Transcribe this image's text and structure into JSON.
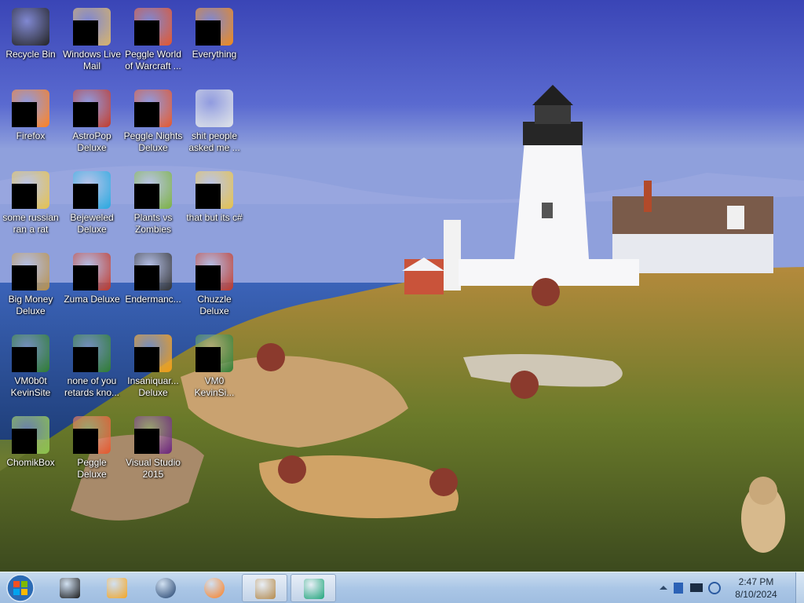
{
  "desktop_icons": [
    {
      "label": "Recycle Bin",
      "icon": "recycle-bin-icon",
      "censored": false
    },
    {
      "label": "Windows Live Mail",
      "icon": "mail-icon",
      "censored": true
    },
    {
      "label": "Peggle World of Warcraft ...",
      "icon": "peggle-icon",
      "censored": true
    },
    {
      "label": "Everything",
      "icon": "search-app-icon",
      "censored": true
    },
    {
      "label": "Firefox",
      "icon": "firefox-icon",
      "censored": true
    },
    {
      "label": "AstroPop Deluxe",
      "icon": "game-icon",
      "censored": true
    },
    {
      "label": "Peggle Nights Deluxe",
      "icon": "peggle-icon",
      "censored": true
    },
    {
      "label": "shit people asked me ...",
      "icon": "folder-icon",
      "censored": false
    },
    {
      "label": "some russian ran a rat",
      "icon": "file-icon",
      "censored": true
    },
    {
      "label": "Bejeweled Deluxe",
      "icon": "gem-icon",
      "censored": true
    },
    {
      "label": "Plants vs Zombies",
      "icon": "plant-icon",
      "censored": true
    },
    {
      "label": "that but its c#",
      "icon": "file-icon",
      "censored": true
    },
    {
      "label": "Big Money Deluxe",
      "icon": "money-icon",
      "censored": true
    },
    {
      "label": "Zuma Deluxe",
      "icon": "game-icon",
      "censored": true
    },
    {
      "label": "Endermanc...",
      "icon": "terminal-icon",
      "censored": true
    },
    {
      "label": "Chuzzle Deluxe",
      "icon": "game-icon",
      "censored": true
    },
    {
      "label": "VM0b0t KevinSite",
      "icon": "app-icon",
      "censored": true
    },
    {
      "label": "none of you retards kno...",
      "icon": "app-icon",
      "censored": true
    },
    {
      "label": "Insaniquar... Deluxe",
      "icon": "fish-icon",
      "censored": true
    },
    {
      "label": "VM0 KevinSi...",
      "icon": "app-icon",
      "censored": true
    },
    {
      "label": "ChomikBox",
      "icon": "box-icon",
      "censored": true
    },
    {
      "label": "Peggle Deluxe",
      "icon": "peggle-icon",
      "censored": true
    },
    {
      "label": "Visual Studio 2015",
      "icon": "visual-studio-icon",
      "censored": true
    }
  ],
  "taskbar": {
    "pinned": [
      {
        "name": "terminal-icon",
        "active": false
      },
      {
        "name": "media-player-icon",
        "active": false
      },
      {
        "name": "globe-icon",
        "active": false
      },
      {
        "name": "firefox-icon",
        "active": false
      },
      {
        "name": "money-bag-icon",
        "active": true
      },
      {
        "name": "box-icon",
        "active": true
      }
    ],
    "clock": {
      "time": "2:47 PM",
      "date": "8/10/2024"
    }
  },
  "colors": {
    "taskbar": "#aac6e6",
    "sky": "#4c5fcb",
    "sea": "#2f5aa6"
  }
}
